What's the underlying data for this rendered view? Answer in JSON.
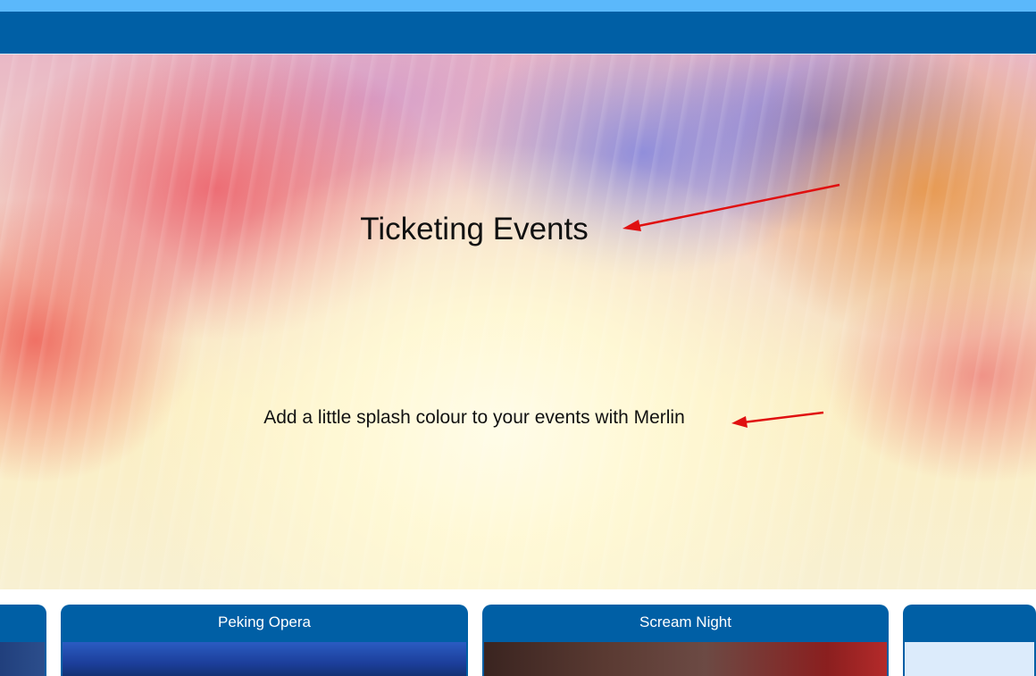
{
  "hero": {
    "title": "Ticketing Events",
    "subtitle": "Add a little splash colour to your events with Merlin"
  },
  "events": [
    {
      "title": ""
    },
    {
      "title": "Peking Opera"
    },
    {
      "title": "Scream Night"
    },
    {
      "title": ""
    }
  ],
  "colors": {
    "top_strip": "#5bb8fb",
    "navbar": "#005fa5",
    "card_header": "#005fa5",
    "annotation_arrow": "#e01010"
  }
}
